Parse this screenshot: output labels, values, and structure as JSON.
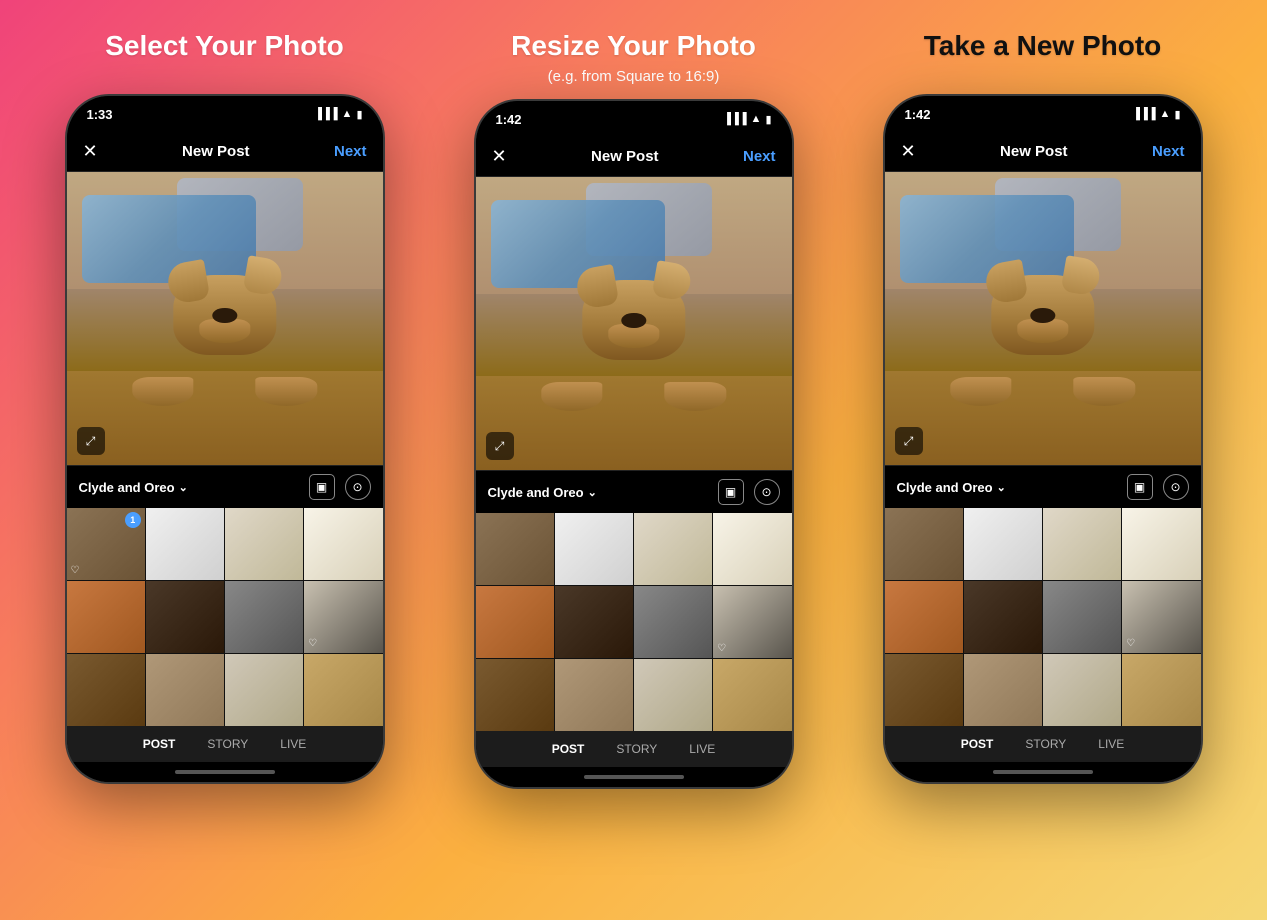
{
  "background": {
    "gradient_start": "#f0437a",
    "gradient_end": "#f5d775"
  },
  "sections": [
    {
      "id": "select",
      "title": "Select Your Photo",
      "subtitle": null,
      "title_color": "white"
    },
    {
      "id": "resize",
      "title": "Resize Your Photo",
      "subtitle": "(e.g. from Square to 16:9)",
      "title_color": "white"
    },
    {
      "id": "take",
      "title": "Take a New Photo",
      "subtitle": null,
      "title_color": "dark"
    }
  ],
  "phones": [
    {
      "id": "phone1",
      "status_time": "1:33",
      "header_title": "New Post",
      "header_next": "Next",
      "gallery_label": "Clyde and Oreo",
      "tab_active": "POST",
      "tabs": [
        "POST",
        "STORY",
        "LIVE"
      ]
    },
    {
      "id": "phone2",
      "status_time": "1:42",
      "header_title": "New Post",
      "header_next": "Next",
      "gallery_label": "Clyde and Oreo",
      "tab_active": "POST",
      "tabs": [
        "POST",
        "STORY",
        "LIVE"
      ]
    },
    {
      "id": "phone3",
      "status_time": "1:42",
      "header_title": "New Post",
      "header_next": "Next",
      "gallery_label": "Clyde and Oreo",
      "tab_active": "POST",
      "tabs": [
        "POST",
        "STORY",
        "LIVE"
      ]
    }
  ],
  "icons": {
    "close": "✕",
    "expand": "⤢",
    "chevron_down": "⌄",
    "heart": "♡",
    "multi_select": "▣",
    "camera": "⊙",
    "wifi": "▲",
    "signal": "▐▐▐",
    "battery": "▮"
  }
}
